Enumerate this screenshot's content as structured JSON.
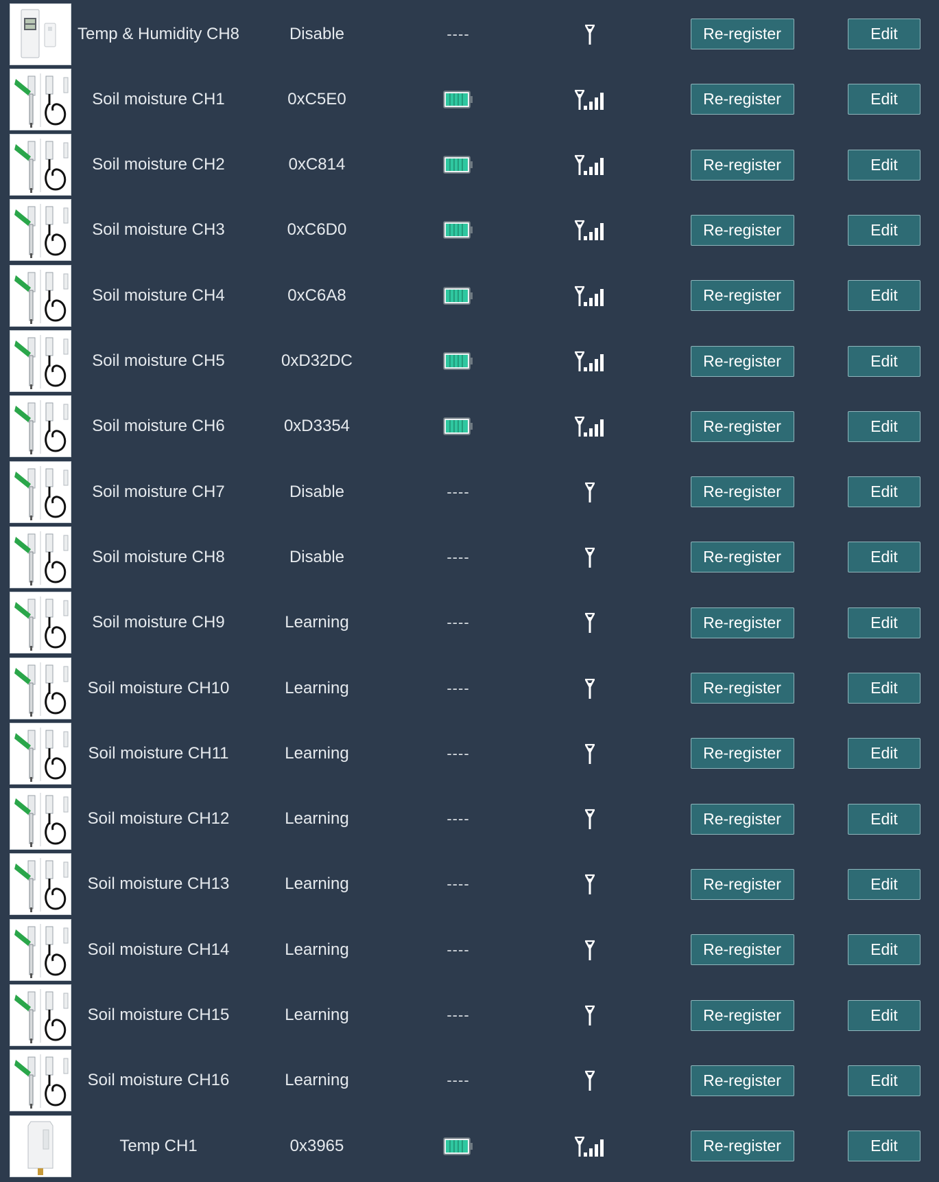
{
  "colors": {
    "background": "#2d3b4d",
    "button_bg": "#2e6b74",
    "button_border": "#8fb6bc",
    "battery_fill": "#2fc7a0",
    "text": "#e6eaee"
  },
  "rows": [
    {
      "image": "temp-humidity-sensor-image",
      "name": "Temp & Humidity CH8",
      "id": "Disable",
      "battery": "----",
      "signal": "antenna-only",
      "rereg_label": "Re-register",
      "edit_label": "Edit"
    },
    {
      "image": "soil-moisture-sensor-image",
      "name": "Soil moisture CH1",
      "id": "0xC5E0",
      "battery": "full",
      "signal": "antenna-bars",
      "rereg_label": "Re-register",
      "edit_label": "Edit"
    },
    {
      "image": "soil-moisture-sensor-image",
      "name": "Soil moisture CH2",
      "id": "0xC814",
      "battery": "full",
      "signal": "antenna-bars",
      "rereg_label": "Re-register",
      "edit_label": "Edit"
    },
    {
      "image": "soil-moisture-sensor-image",
      "name": "Soil moisture CH3",
      "id": "0xC6D0",
      "battery": "full",
      "signal": "antenna-bars",
      "rereg_label": "Re-register",
      "edit_label": "Edit"
    },
    {
      "image": "soil-moisture-sensor-image",
      "name": "Soil moisture CH4",
      "id": "0xC6A8",
      "battery": "full",
      "signal": "antenna-bars",
      "rereg_label": "Re-register",
      "edit_label": "Edit"
    },
    {
      "image": "soil-moisture-sensor-image",
      "name": "Soil moisture CH5",
      "id": "0xD32DC",
      "battery": "full",
      "signal": "antenna-bars",
      "rereg_label": "Re-register",
      "edit_label": "Edit"
    },
    {
      "image": "soil-moisture-sensor-image",
      "name": "Soil moisture CH6",
      "id": "0xD3354",
      "battery": "full",
      "signal": "antenna-bars",
      "rereg_label": "Re-register",
      "edit_label": "Edit"
    },
    {
      "image": "soil-moisture-sensor-image",
      "name": "Soil moisture CH7",
      "id": "Disable",
      "battery": "----",
      "signal": "antenna-only",
      "rereg_label": "Re-register",
      "edit_label": "Edit"
    },
    {
      "image": "soil-moisture-sensor-image",
      "name": "Soil moisture CH8",
      "id": "Disable",
      "battery": "----",
      "signal": "antenna-only",
      "rereg_label": "Re-register",
      "edit_label": "Edit"
    },
    {
      "image": "soil-moisture-sensor-image",
      "name": "Soil moisture CH9",
      "id": "Learning",
      "battery": "----",
      "signal": "antenna-only",
      "rereg_label": "Re-register",
      "edit_label": "Edit"
    },
    {
      "image": "soil-moisture-sensor-image",
      "name": "Soil moisture CH10",
      "id": "Learning",
      "battery": "----",
      "signal": "antenna-only",
      "rereg_label": "Re-register",
      "edit_label": "Edit"
    },
    {
      "image": "soil-moisture-sensor-image",
      "name": "Soil moisture CH11",
      "id": "Learning",
      "battery": "----",
      "signal": "antenna-only",
      "rereg_label": "Re-register",
      "edit_label": "Edit"
    },
    {
      "image": "soil-moisture-sensor-image",
      "name": "Soil moisture CH12",
      "id": "Learning",
      "battery": "----",
      "signal": "antenna-only",
      "rereg_label": "Re-register",
      "edit_label": "Edit"
    },
    {
      "image": "soil-moisture-sensor-image",
      "name": "Soil moisture CH13",
      "id": "Learning",
      "battery": "----",
      "signal": "antenna-only",
      "rereg_label": "Re-register",
      "edit_label": "Edit"
    },
    {
      "image": "soil-moisture-sensor-image",
      "name": "Soil moisture CH14",
      "id": "Learning",
      "battery": "----",
      "signal": "antenna-only",
      "rereg_label": "Re-register",
      "edit_label": "Edit"
    },
    {
      "image": "soil-moisture-sensor-image",
      "name": "Soil moisture CH15",
      "id": "Learning",
      "battery": "----",
      "signal": "antenna-only",
      "rereg_label": "Re-register",
      "edit_label": "Edit"
    },
    {
      "image": "soil-moisture-sensor-image",
      "name": "Soil moisture CH16",
      "id": "Learning",
      "battery": "----",
      "signal": "antenna-only",
      "rereg_label": "Re-register",
      "edit_label": "Edit"
    },
    {
      "image": "temp-sensor-image",
      "name": "Temp CH1",
      "id": "0x3965",
      "battery": "full",
      "signal": "antenna-bars",
      "rereg_label": "Re-register",
      "edit_label": "Edit"
    }
  ]
}
